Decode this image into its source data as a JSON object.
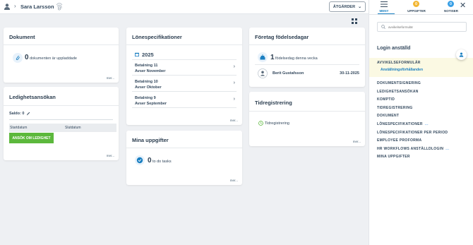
{
  "header": {
    "user_name": "Sara Larsson",
    "actions_label": "ÅTGÄRDER"
  },
  "documents": {
    "title": "Dokument",
    "count": "0",
    "text": "dokumenten är uppladdade",
    "more": "mer..."
  },
  "payslips": {
    "title": "Lönespecifikationer",
    "year": "2025",
    "items": [
      {
        "title": "Betalning 11",
        "subtitle": "Avser November"
      },
      {
        "title": "Betalning 10",
        "subtitle": "Avser Oktober"
      },
      {
        "title": "Betalning 9",
        "subtitle": "Avser September"
      }
    ],
    "more": "mer..."
  },
  "birthdays": {
    "title": "Företag födelsedagar",
    "count": "1",
    "text": "födelsedag denna vecka",
    "person_name": "Berit Gustafsson",
    "person_date": "30-11-2025"
  },
  "leave": {
    "title": "Ledighetsansökan",
    "balance_label": "Saldo: 0",
    "col_start": "Startdatum",
    "col_end": "Slutdatum",
    "apply_button": "ANSÖK OM LEDIGHET",
    "more": "mer..."
  },
  "tasks": {
    "title": "Mina uppgifter",
    "count": "0",
    "text": "to do tasks",
    "more": "mer..."
  },
  "timereg": {
    "title": "Tidregistrering",
    "item": "Tidregistrering",
    "more": "mer..."
  },
  "right_panel": {
    "tabs": [
      {
        "label": "MENY"
      },
      {
        "label": "UPPGIFTER"
      },
      {
        "label": "NOTISER"
      }
    ],
    "tasks_badge": "0",
    "notices_badge": "0",
    "search_placeholder": "avvikelseformulär",
    "section_title": "Login anställd",
    "nav": [
      {
        "label": "AVVIKELSEFORMULÄR"
      },
      {
        "label": "DOKUMENTSIGNERING"
      },
      {
        "label": "LEDIGHETSANSÖKAN"
      },
      {
        "label": "KOMPTID"
      },
      {
        "label": "TIDREGISTRERING"
      },
      {
        "label": "DOKUMENT"
      },
      {
        "label": "LÖNESPECIFIKATIONER"
      },
      {
        "label": "LÖNESPECIFIKATIONER PER PERIOD"
      },
      {
        "label": "EMPLOYEE PROFORMA"
      },
      {
        "label": "HR WORKFLOWS ANSTÄLLDLOGIN"
      },
      {
        "label": "MINA UPPGIFTER"
      }
    ],
    "sub_item": "Anställningsförhållanden",
    "more_dots": "..."
  },
  "colors": {
    "accent": "#1a7fc1",
    "primary_button": "#5cb83c",
    "task_badge": "#f2b632",
    "notice_badge": "#3aa0e6",
    "highlight": "#fbf9e3"
  }
}
